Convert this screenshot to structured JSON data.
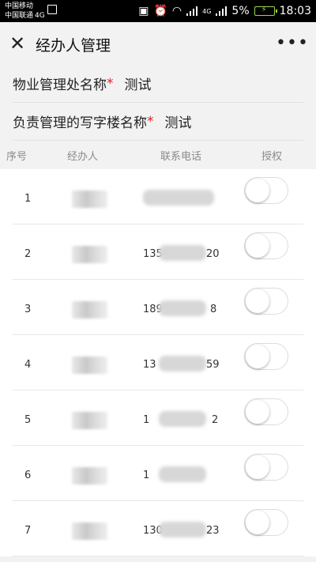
{
  "statusbar": {
    "carrier1": "中国移动",
    "carrier2": "中国联通",
    "carrier2_net": "4G",
    "net": "4G",
    "battery": "5%",
    "time": "18:03"
  },
  "titlebar": {
    "title": "经办人管理",
    "close_icon": "close-icon",
    "more_icon": "more-icon"
  },
  "info": {
    "row1": {
      "label": "物业管理处名称",
      "required": "*",
      "value": "测试"
    },
    "row2": {
      "label": "负责管理的写字楼名称",
      "required": "*",
      "value": "测试"
    }
  },
  "table": {
    "headers": {
      "index": "序号",
      "agent": "经办人",
      "phone": "联系电话",
      "auth": "授权"
    },
    "rows": [
      {
        "index": "1",
        "phone_prefix": "",
        "phone_suffix": ""
      },
      {
        "index": "2",
        "phone_prefix": "135",
        "phone_suffix": "20"
      },
      {
        "index": "3",
        "phone_prefix": "189",
        "phone_suffix": "8"
      },
      {
        "index": "4",
        "phone_prefix": "13",
        "phone_suffix": "59"
      },
      {
        "index": "5",
        "phone_prefix": "1",
        "phone_suffix": "2"
      },
      {
        "index": "6",
        "phone_prefix": "1",
        "phone_suffix": ""
      },
      {
        "index": "7",
        "phone_prefix": "130",
        "phone_suffix": "23"
      }
    ]
  }
}
